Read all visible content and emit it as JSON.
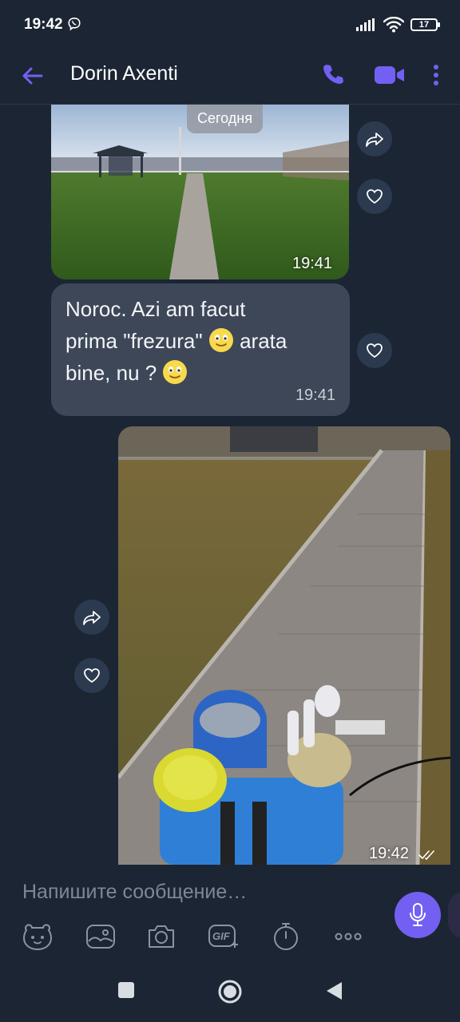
{
  "status_bar": {
    "time": "19:42",
    "battery": "17"
  },
  "app_bar": {
    "contact_name": "Dorin Axenti",
    "icons": [
      "back-arrow-icon",
      "phone-icon",
      "video-call-icon",
      "more-vert-icon"
    ],
    "accent_color": "#7360f2"
  },
  "chat": {
    "date_chip": "Сегодня",
    "messages": [
      {
        "type": "image",
        "direction": "incoming",
        "time": "19:41",
        "content": "photo of lawn with paved path and gazebo"
      },
      {
        "type": "text",
        "direction": "incoming",
        "time": "19:41",
        "lines": [
          "Noroc. Azi am facut",
          "prima \"frezura\"",
          "arata",
          "bine, nu ?"
        ],
        "emoji": "smiling-face-emoji"
      },
      {
        "type": "image",
        "direction": "outgoing",
        "time": "19:42",
        "status": "read",
        "content": "photo of paved path, dry lawn, bucket and sprayer"
      }
    ]
  },
  "composer": {
    "placeholder": "Напишите сообщение…",
    "tools": [
      "sticker-icon",
      "gallery-icon",
      "camera-icon",
      "gif-icon",
      "timer-icon",
      "more-horiz-icon"
    ],
    "gif_label": "GIF"
  },
  "colors": {
    "background": "#1c2533",
    "bubble_incoming": "#3d4758",
    "action_button": "#2c3a4f"
  }
}
